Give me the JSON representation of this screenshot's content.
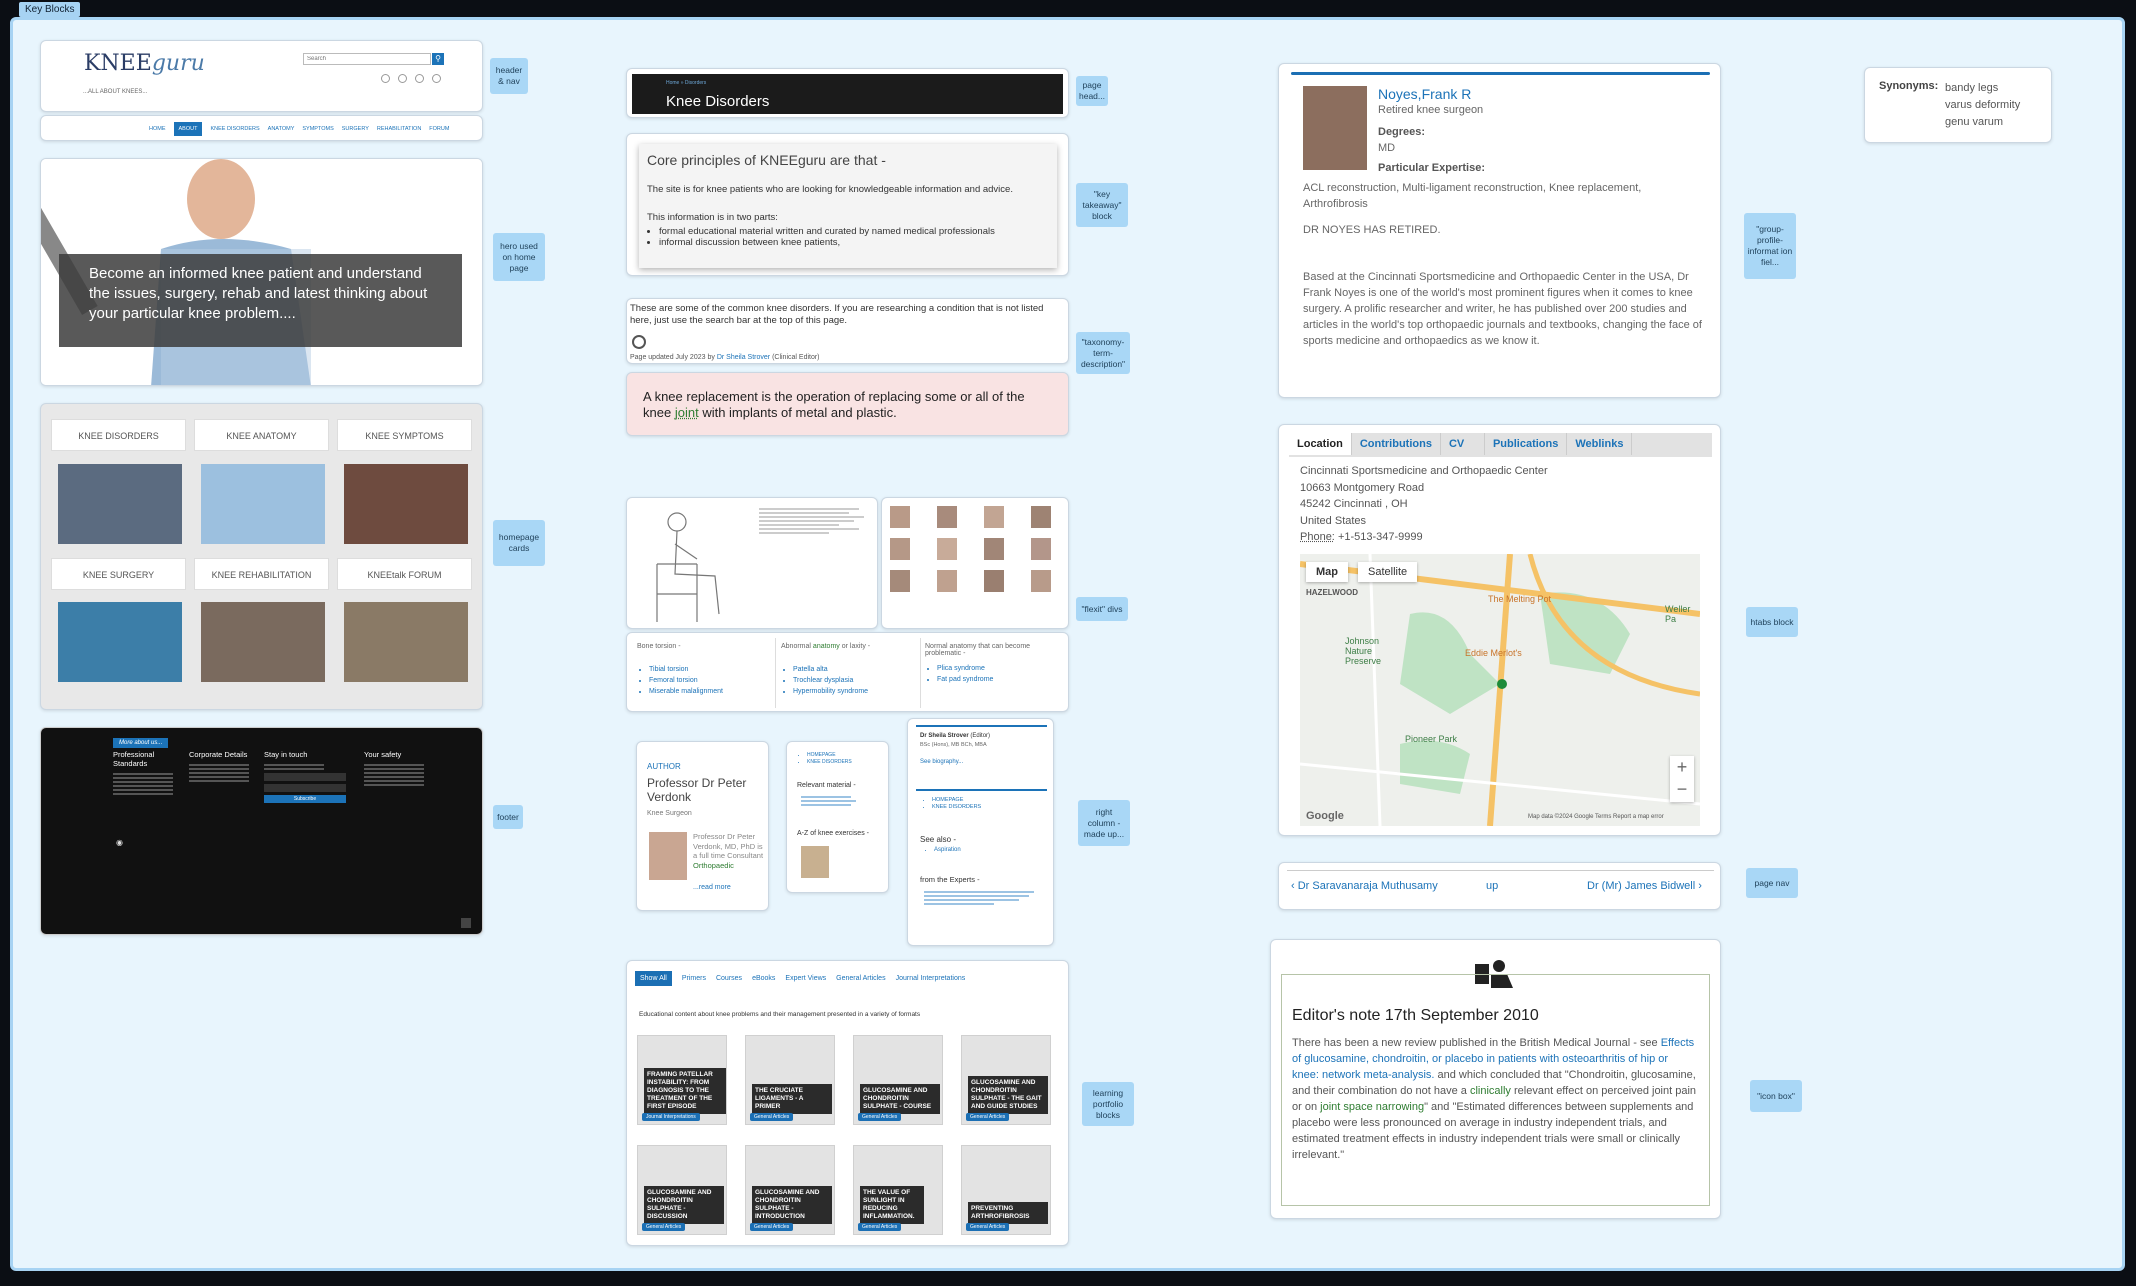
{
  "overlay": {
    "label": "Key Blocks"
  },
  "notes": {
    "header_nav": "header & nav",
    "hero": "hero used on home page",
    "homepage_cards": "homepage cards",
    "footer": "footer",
    "page_head": "page head...",
    "key_takeaway": "\"key takeaway\" block",
    "taxonomy": "\"taxonomy-term-description\"",
    "flexit": "\"flexit\" divs",
    "right_column": "right column - made up...",
    "learning": "learning portfolio blocks",
    "group_profile": "\"group-profile-informat ion fiel...",
    "htabs": "htabs block",
    "page_nav": "page nav",
    "icon_box": "\"icon box\""
  },
  "header": {
    "logo_main": "KNEE",
    "logo_script": "guru",
    "tagline": "...ALL ABOUT KNEES...",
    "search_placeholder": "Search",
    "nav": [
      "HOME",
      "ABOUT",
      "KNEE DISORDERS",
      "ANATOMY",
      "SYMPTOMS",
      "SURGERY",
      "REHABILITATION",
      "FORUM"
    ]
  },
  "hero": {
    "text": "Become an informed knee patient and understand the issues, surgery, rehab and latest thinking about your particular knee problem...."
  },
  "home_cards": [
    {
      "label": "KNEE DISORDERS"
    },
    {
      "label": "KNEE ANATOMY"
    },
    {
      "label": "KNEE SYMPTOMS"
    },
    {
      "label": "KNEE SURGERY"
    },
    {
      "label": "KNEE REHABILITATION"
    },
    {
      "label": "KNEEtalk FORUM"
    }
  ],
  "footer": {
    "tab": "More about us...",
    "cols": [
      "Professional Standards",
      "Corporate Details",
      "Stay in touch",
      "Your safety"
    ],
    "subscribe": "Subscribe"
  },
  "page_head": {
    "breadcrumb": "Home » Disorders",
    "title": "Knee Disorders"
  },
  "takeaway": {
    "title": "Core principles of KNEEguru are that -",
    "p1": "The site is for knee patients who are looking for knowledgeable information and advice.",
    "p2": "This information is in two parts:",
    "items": [
      "formal educational material written and curated by named medical professionals",
      "informal discussion between knee patients,"
    ]
  },
  "taxonomy": {
    "text": "These are some of the common knee disorders. If you are researching a condition that is not listed here, just use the search bar at the top of this page.",
    "updated": "Page updated July 2023 by",
    "editor": "Dr Sheila Strover",
    "role": "(Clinical Editor)"
  },
  "definition": {
    "before": "A knee replacement is the operation of replacing some or all of the knee",
    "link": "joint",
    "after": "with implants of metal and plastic."
  },
  "flexit_lists": [
    {
      "head": "Bone torsion -",
      "items": [
        "Tibial torsion",
        "Femoral torsion",
        "Miserable malalignment"
      ]
    },
    {
      "head_a": "Abnormal",
      "head_link": "anatomy",
      "head_b": "or laxity -",
      "items": [
        "Patella alta",
        "Trochlear dysplasia",
        "Hypermobility syndrome"
      ]
    },
    {
      "head": "Normal anatomy that can become problematic -",
      "items": [
        "Plica syndrome",
        "Fat pad syndrome"
      ]
    }
  ],
  "author": {
    "kicker": "AUTHOR",
    "name": "Professor Dr Peter Verdonk",
    "role": "Knee Surgeon",
    "bio_a": "Professor Dr Peter Verdonk, MD, PhD is a full time Consultant",
    "bio_link": "Orthopaedic",
    "more": "...read more"
  },
  "right_col": {
    "relevant": "Relevant material -",
    "az": "A-Z of knee exercises -",
    "see_also": "See also -",
    "see_item": "Aspiration",
    "from_experts": "from the Experts -",
    "editor_name": "Dr Sheila Strover",
    "editor_role": "(Editor)",
    "editor_creds": "BSc (Hons), MB BCh, MBA",
    "see_bio": "See biography...",
    "links": [
      "HOMEPAGE",
      "KNEE DISORDERS"
    ]
  },
  "learning": {
    "tabs": [
      "Show All",
      "Primers",
      "Courses",
      "eBooks",
      "Expert Views",
      "General Articles",
      "Journal Interpretations"
    ],
    "desc": "Educational content about knee problems and their management presented in a variety of formats",
    "items": [
      {
        "title": "FRAMING PATELLAR INSTABILITY: FROM DIAGNOSIS TO THE TREATMENT OF THE FIRST EPISODE",
        "tag": "Journal Interpretations"
      },
      {
        "title": "THE CRUCIATE LIGAMENTS - A PRIMER",
        "tag": "General Articles"
      },
      {
        "title": "GLUCOSAMINE AND CHONDROITIN SULPHATE - COURSE",
        "tag": "General Articles"
      },
      {
        "title": "GLUCOSAMINE AND CHONDROITIN SULPHATE - THE GAIT AND GUIDE STUDIES",
        "tag": "General Articles"
      },
      {
        "title": "GLUCOSAMINE AND CHONDROITIN SULPHATE - DISCUSSION",
        "tag": "General Articles"
      },
      {
        "title": "GLUCOSAMINE AND CHONDROITIN SULPHATE - INTRODUCTION",
        "tag": "General Articles"
      },
      {
        "title": "THE VALUE OF SUNLIGHT IN REDUCING INFLAMMATION.",
        "tag": "General Articles"
      },
      {
        "title": "PREVENTING ARTHROFIBROSIS",
        "tag": "General Articles"
      }
    ]
  },
  "profile": {
    "name": "Noyes,Frank R",
    "role": "Retired knee surgeon",
    "degrees_label": "Degrees:",
    "degrees": "MD",
    "expertise_label": "Particular Expertise:",
    "expertise": "ACL reconstruction, Multi-ligament reconstruction, Knee replacement, Arthrofibrosis",
    "retired": "DR NOYES HAS RETIRED.",
    "bio": "Based at the Cincinnati Sportsmedicine and Orthopaedic Center in the USA, Dr Frank Noyes is one of the world's most prominent figures when it comes to knee surgery. A prolific researcher and writer, he has published over 200 studies and articles in the world's top orthopaedic journals and textbooks, changing the face of sports medicine and orthopaedics as we know it."
  },
  "synonyms": {
    "label": "Synonyms:",
    "items": [
      "bandy legs",
      "varus deformity",
      "genu varum"
    ]
  },
  "htabs": {
    "tabs": [
      "Location",
      "Contributions",
      "CV",
      "Publications",
      "Weblinks"
    ],
    "address": [
      "Cincinnati Sportsmedicine and Orthopaedic Center",
      "10663 Montgomery Road",
      "45242 Cincinnati , OH",
      "United States"
    ],
    "phone_label": "Phone:",
    "phone": "+1-513-347-9999",
    "map_btn": "Map",
    "sat_btn": "Satellite",
    "map_labels": {
      "hazelwood": "HAZELWOOD",
      "johnson": "Johnson Nature Preserve",
      "melting": "The Melting Pot",
      "eddie": "Eddie Merlot's",
      "pioneer": "Pioneer Park",
      "weller": "Weller Pa"
    },
    "map_footer": "Map data ©2024 Google   Terms   Report a map error",
    "google": "Google"
  },
  "pagenav": {
    "prev": "‹ Dr Saravanaraja Muthusamy",
    "up": "up",
    "next": "Dr (Mr) James Bidwell ›"
  },
  "iconbox": {
    "title": "Editor's note 17th September 2010",
    "t1": "There has been a new review published in the British Medical Journal - see",
    "link1": "Effects of glucosamine, chondroitin, or placebo in patients with osteoarthritis of hip or knee: network meta-analysis.",
    "t2": "and which concluded that \"Chondroitin, glucosamine, and their combination do not have a",
    "link2": "clinically",
    "t3": "relevant effect on perceived joint pain or on",
    "link3": "joint space narrowing",
    "t4": "\" and \"Estimated differences between supplements and placebo were less pronounced on average in industry independent trials, and estimated treatment effects in industry independent trials were small or clinically irrelevant.\""
  }
}
